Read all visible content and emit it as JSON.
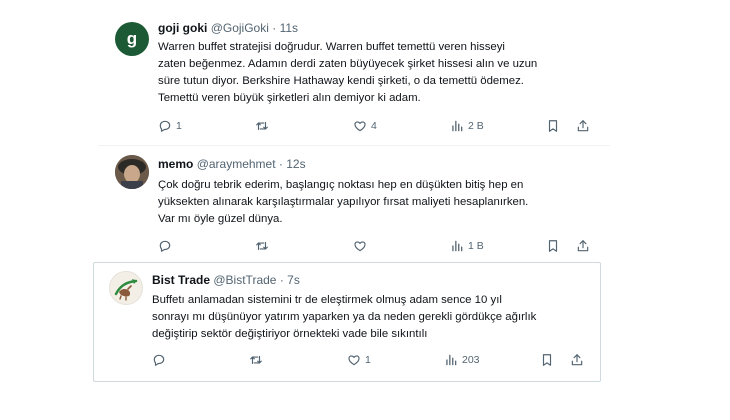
{
  "tweets": [
    {
      "avatar_letter": "g",
      "name": "goji goki",
      "handle": "@GojiGoki",
      "dot": "·",
      "time": "11s",
      "lines": [
        "Warren buffet stratejisi doğrudur. Warren buffet temettü veren hisseyi",
        "zaten beğenmez. Adamın derdi zaten büyüyecek şirket hissesi alın ve uzun",
        "süre tutun diyor. Berkshire Hathaway kendi şirketi, o da temettü ödemez.",
        "Temettü veren büyük şirketleri alın demiyor ki adam."
      ],
      "counts": {
        "reply": "1",
        "retweet": "",
        "like": "4",
        "views": "2 B"
      }
    },
    {
      "name": "memo",
      "handle": "@araymehmet",
      "dot": "·",
      "time": "12s",
      "lines": [
        "Çok doğru tebrik ederim, başlangıç noktası hep en düşükten bitiş hep en",
        "yüksekten alınarak karşılaştırmalar yapılıyor fırsat maliyeti hesaplanırken.",
        "Var mı öyle güzel dünya."
      ],
      "counts": {
        "reply": "",
        "retweet": "",
        "like": "",
        "views": "1 B"
      }
    },
    {
      "name": "Bist Trade",
      "handle": "@BistTrade",
      "dot": "·",
      "time": "7s",
      "lines": [
        "Buffetı anlamadan sistemini tr de eleştirmek olmuş adam sence 10 yıl",
        "sonrayı mı düşünüyor yatırım yaparken ya da neden gerekli gördükçe ağırlık",
        "değiştirip sektör değiştiriyor örnekteki vade bile sıkıntılı"
      ],
      "counts": {
        "reply": "",
        "retweet": "",
        "like": "1",
        "views": "203"
      }
    }
  ],
  "icons": {
    "reply": "reply-icon",
    "retweet": "retweet-icon",
    "like": "like-icon",
    "views": "views-icon",
    "bookmark": "bookmark-icon",
    "share": "share-icon"
  },
  "colors": {
    "text": "#0f1419",
    "secondary": "#536471",
    "border": "#cfd9de",
    "avatar_goji": "#1c5a36"
  }
}
